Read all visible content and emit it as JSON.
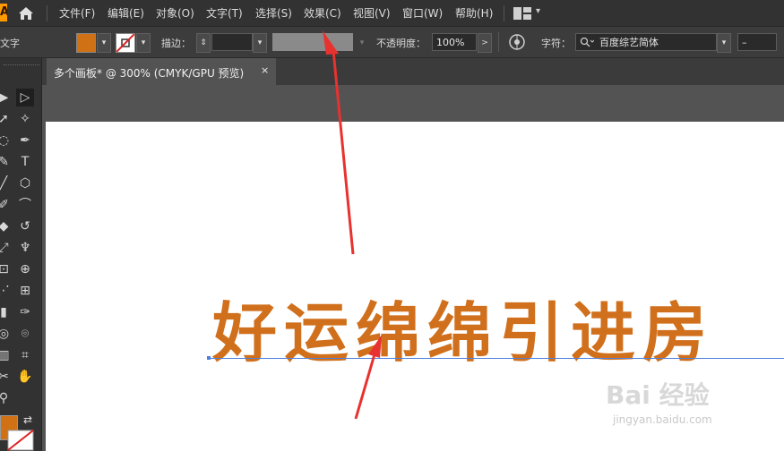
{
  "menubar": {
    "logo": "Ai",
    "items": [
      "文件(F)",
      "编辑(E)",
      "对象(O)",
      "文字(T)",
      "选择(S)",
      "效果(C)",
      "视图(V)",
      "窗口(W)",
      "帮助(H)"
    ]
  },
  "control_bar": {
    "tool_label": "文字",
    "stroke_label": "描边：",
    "opacity_label": "不透明度：",
    "opacity_value": "100%",
    "char_label": "字符：",
    "font_name": "百度综艺简体",
    "font_style": "–",
    "chevron": "▾",
    "arrow": ">"
  },
  "document": {
    "tab_title": "多个画板* @ 300% (CMYK/GPU 预览)",
    "close": "×"
  },
  "artboard": {
    "text": "好运绵绵引进房"
  },
  "watermark": {
    "logo": "Bai 经验",
    "url": "jingyan.baidu.com"
  },
  "colors": {
    "fill": "#d07115",
    "annotation_arrow": "#e8322f",
    "selection": "#4d7fe0"
  }
}
